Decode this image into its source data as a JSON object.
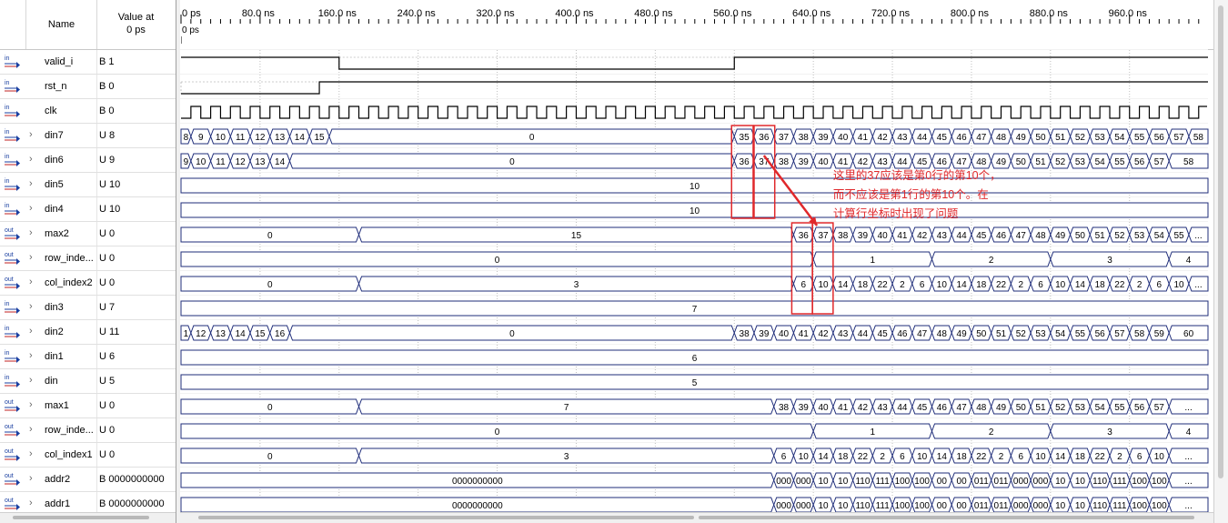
{
  "header": {
    "name_col": "Name",
    "value_col_line1": "Value at",
    "value_col_line2": "0 ps"
  },
  "timeline": {
    "ticks": [
      "0 ps",
      "80.0 ns",
      "160.0 ns",
      "240.0 ns",
      "320.0 ns",
      "400.0 ns",
      "480.0 ns",
      "560.0 ns",
      "640.0 ns",
      "720.0 ns",
      "800.0 ns",
      "880.0 ns",
      "960.0 ns"
    ],
    "cursor_label": "0 ps",
    "end_ns": 1038.5
  },
  "signals": [
    {
      "name": "valid_i",
      "value": "B 1",
      "dir": "in",
      "expandable": false
    },
    {
      "name": "rst_n",
      "value": "B 0",
      "dir": "in",
      "expandable": false
    },
    {
      "name": "clk",
      "value": "B 0",
      "dir": "in",
      "expandable": false
    },
    {
      "name": "din7",
      "value": "U 8",
      "dir": "in",
      "expandable": true
    },
    {
      "name": "din6",
      "value": "U 9",
      "dir": "in",
      "expandable": true
    },
    {
      "name": "din5",
      "value": "U 10",
      "dir": "in",
      "expandable": true
    },
    {
      "name": "din4",
      "value": "U 10",
      "dir": "in",
      "expandable": true
    },
    {
      "name": "max2",
      "value": "U 0",
      "dir": "out",
      "expandable": true
    },
    {
      "name": "row_inde...",
      "value": "U 0",
      "dir": "out",
      "expandable": true
    },
    {
      "name": "col_index2",
      "value": "U 0",
      "dir": "out",
      "expandable": true
    },
    {
      "name": "din3",
      "value": "U 7",
      "dir": "in",
      "expandable": true
    },
    {
      "name": "din2",
      "value": "U 11",
      "dir": "in",
      "expandable": true
    },
    {
      "name": "din1",
      "value": "U 6",
      "dir": "in",
      "expandable": true
    },
    {
      "name": "din",
      "value": "U 5",
      "dir": "in",
      "expandable": true
    },
    {
      "name": "max1",
      "value": "U 0",
      "dir": "out",
      "expandable": true
    },
    {
      "name": "row_inde...",
      "value": "U 0",
      "dir": "out",
      "expandable": true
    },
    {
      "name": "col_index1",
      "value": "U 0",
      "dir": "out",
      "expandable": true
    },
    {
      "name": "addr2",
      "value": "B 0000000000",
      "dir": "out",
      "expandable": true
    },
    {
      "name": "addr1",
      "value": "B 0000000000",
      "dir": "out",
      "expandable": true
    }
  ],
  "waveforms": {
    "valid_i": {
      "type": "bit",
      "edges": [
        [
          0,
          1
        ],
        [
          160,
          0
        ],
        [
          560,
          1
        ]
      ]
    },
    "rst_n": {
      "type": "bit",
      "edges": [
        [
          0,
          0
        ],
        [
          140,
          1
        ]
      ]
    },
    "clk": {
      "type": "clock",
      "period_ns": 20,
      "start_level": 0
    },
    "din7": {
      "type": "bus",
      "segs": [
        [
          0,
          "8"
        ],
        [
          10,
          "9"
        ],
        [
          30,
          "10"
        ],
        [
          50,
          "11"
        ],
        [
          70,
          "12"
        ],
        [
          90,
          "13"
        ],
        [
          110,
          "14"
        ],
        [
          130,
          "15"
        ],
        [
          150,
          "0"
        ],
        [
          560,
          "35"
        ],
        [
          580,
          "36"
        ],
        [
          600,
          "37"
        ],
        [
          620,
          "38"
        ],
        [
          640,
          "39"
        ],
        [
          660,
          "40"
        ],
        [
          680,
          "41"
        ],
        [
          700,
          "42"
        ],
        [
          720,
          "43"
        ],
        [
          740,
          "44"
        ],
        [
          760,
          "45"
        ],
        [
          780,
          "46"
        ],
        [
          800,
          "47"
        ],
        [
          820,
          "48"
        ],
        [
          840,
          "49"
        ],
        [
          860,
          "50"
        ],
        [
          880,
          "51"
        ],
        [
          900,
          "52"
        ],
        [
          920,
          "53"
        ],
        [
          940,
          "54"
        ],
        [
          960,
          "55"
        ],
        [
          980,
          "56"
        ],
        [
          1000,
          "57"
        ],
        [
          1020,
          "58"
        ]
      ]
    },
    "din6": {
      "type": "bus",
      "segs": [
        [
          0,
          "9"
        ],
        [
          10,
          "10"
        ],
        [
          30,
          "11"
        ],
        [
          50,
          "12"
        ],
        [
          70,
          "13"
        ],
        [
          90,
          "14"
        ],
        [
          110,
          "0"
        ],
        [
          560,
          "36"
        ],
        [
          580,
          "37"
        ],
        [
          600,
          "38"
        ],
        [
          620,
          "39"
        ],
        [
          640,
          "40"
        ],
        [
          660,
          "41"
        ],
        [
          680,
          "42"
        ],
        [
          700,
          "43"
        ],
        [
          720,
          "44"
        ],
        [
          740,
          "45"
        ],
        [
          760,
          "46"
        ],
        [
          780,
          "47"
        ],
        [
          800,
          "48"
        ],
        [
          820,
          "49"
        ],
        [
          840,
          "50"
        ],
        [
          860,
          "51"
        ],
        [
          880,
          "52"
        ],
        [
          900,
          "53"
        ],
        [
          920,
          "54"
        ],
        [
          940,
          "55"
        ],
        [
          960,
          "56"
        ],
        [
          980,
          "57"
        ],
        [
          1000,
          "58"
        ]
      ]
    },
    "din5": {
      "type": "bus",
      "segs": [
        [
          0,
          "10"
        ]
      ]
    },
    "din4": {
      "type": "bus",
      "segs": [
        [
          0,
          "10"
        ]
      ]
    },
    "max2": {
      "type": "bus",
      "segs": [
        [
          0,
          "0"
        ],
        [
          180,
          "15"
        ],
        [
          620,
          "36"
        ],
        [
          640,
          "37"
        ],
        [
          660,
          "38"
        ],
        [
          680,
          "39"
        ],
        [
          700,
          "40"
        ],
        [
          720,
          "41"
        ],
        [
          740,
          "42"
        ],
        [
          760,
          "43"
        ],
        [
          780,
          "44"
        ],
        [
          800,
          "45"
        ],
        [
          820,
          "46"
        ],
        [
          840,
          "47"
        ],
        [
          860,
          "48"
        ],
        [
          880,
          "49"
        ],
        [
          900,
          "50"
        ],
        [
          920,
          "51"
        ],
        [
          940,
          "52"
        ],
        [
          960,
          "53"
        ],
        [
          980,
          "54"
        ],
        [
          1000,
          "55"
        ],
        [
          1020,
          "..."
        ]
      ]
    },
    "row_index2": {
      "type": "bus",
      "segs": [
        [
          0,
          "0"
        ],
        [
          640,
          "1"
        ],
        [
          760,
          "2"
        ],
        [
          880,
          "3"
        ],
        [
          1000,
          "4"
        ]
      ]
    },
    "col_index2": {
      "type": "bus",
      "segs": [
        [
          0,
          "0"
        ],
        [
          180,
          "3"
        ],
        [
          620,
          "6"
        ],
        [
          640,
          "10"
        ],
        [
          660,
          "14"
        ],
        [
          680,
          "18"
        ],
        [
          700,
          "22"
        ],
        [
          720,
          "2"
        ],
        [
          740,
          "6"
        ],
        [
          760,
          "10"
        ],
        [
          780,
          "14"
        ],
        [
          800,
          "18"
        ],
        [
          820,
          "22"
        ],
        [
          840,
          "2"
        ],
        [
          860,
          "6"
        ],
        [
          880,
          "10"
        ],
        [
          900,
          "14"
        ],
        [
          920,
          "18"
        ],
        [
          940,
          "22"
        ],
        [
          960,
          "2"
        ],
        [
          980,
          "6"
        ],
        [
          1000,
          "10"
        ],
        [
          1020,
          "..."
        ]
      ]
    },
    "din3": {
      "type": "bus",
      "segs": [
        [
          0,
          "7"
        ]
      ]
    },
    "din2": {
      "type": "bus",
      "segs": [
        [
          0,
          "11"
        ],
        [
          10,
          "12"
        ],
        [
          30,
          "13"
        ],
        [
          50,
          "14"
        ],
        [
          70,
          "15"
        ],
        [
          90,
          "16"
        ],
        [
          110,
          "0"
        ],
        [
          560,
          "38"
        ],
        [
          580,
          "39"
        ],
        [
          600,
          "40"
        ],
        [
          620,
          "41"
        ],
        [
          640,
          "42"
        ],
        [
          660,
          "43"
        ],
        [
          680,
          "44"
        ],
        [
          700,
          "45"
        ],
        [
          720,
          "46"
        ],
        [
          740,
          "47"
        ],
        [
          760,
          "48"
        ],
        [
          780,
          "49"
        ],
        [
          800,
          "50"
        ],
        [
          820,
          "51"
        ],
        [
          840,
          "52"
        ],
        [
          860,
          "53"
        ],
        [
          880,
          "54"
        ],
        [
          900,
          "55"
        ],
        [
          920,
          "56"
        ],
        [
          940,
          "57"
        ],
        [
          960,
          "58"
        ],
        [
          980,
          "59"
        ],
        [
          1000,
          "60"
        ]
      ]
    },
    "din1": {
      "type": "bus",
      "segs": [
        [
          0,
          "6"
        ]
      ]
    },
    "din": {
      "type": "bus",
      "segs": [
        [
          0,
          "5"
        ]
      ]
    },
    "max1": {
      "type": "bus",
      "segs": [
        [
          0,
          "0"
        ],
        [
          180,
          "7"
        ],
        [
          600,
          "38"
        ],
        [
          620,
          "39"
        ],
        [
          640,
          "40"
        ],
        [
          660,
          "41"
        ],
        [
          680,
          "42"
        ],
        [
          700,
          "43"
        ],
        [
          720,
          "44"
        ],
        [
          740,
          "45"
        ],
        [
          760,
          "46"
        ],
        [
          780,
          "47"
        ],
        [
          800,
          "48"
        ],
        [
          820,
          "49"
        ],
        [
          840,
          "50"
        ],
        [
          860,
          "51"
        ],
        [
          880,
          "52"
        ],
        [
          900,
          "53"
        ],
        [
          920,
          "54"
        ],
        [
          940,
          "55"
        ],
        [
          960,
          "56"
        ],
        [
          980,
          "57"
        ],
        [
          1000,
          "..."
        ]
      ]
    },
    "row_index1": {
      "type": "bus",
      "segs": [
        [
          0,
          "0"
        ],
        [
          640,
          "1"
        ],
        [
          760,
          "2"
        ],
        [
          880,
          "3"
        ],
        [
          1000,
          "4"
        ]
      ]
    },
    "col_index1": {
      "type": "bus",
      "segs": [
        [
          0,
          "0"
        ],
        [
          180,
          "3"
        ],
        [
          600,
          "6"
        ],
        [
          620,
          "10"
        ],
        [
          640,
          "14"
        ],
        [
          660,
          "18"
        ],
        [
          680,
          "22"
        ],
        [
          700,
          "2"
        ],
        [
          720,
          "6"
        ],
        [
          740,
          "10"
        ],
        [
          760,
          "14"
        ],
        [
          780,
          "18"
        ],
        [
          800,
          "22"
        ],
        [
          820,
          "2"
        ],
        [
          840,
          "6"
        ],
        [
          860,
          "10"
        ],
        [
          880,
          "14"
        ],
        [
          900,
          "18"
        ],
        [
          920,
          "22"
        ],
        [
          940,
          "2"
        ],
        [
          960,
          "6"
        ],
        [
          980,
          "10"
        ],
        [
          1000,
          "..."
        ]
      ]
    },
    "addr2": {
      "type": "bus",
      "segs": [
        [
          0,
          "0000000000"
        ],
        [
          600,
          "000"
        ],
        [
          620,
          "000"
        ],
        [
          640,
          "10"
        ],
        [
          660,
          "10"
        ],
        [
          680,
          "110"
        ],
        [
          700,
          "111"
        ],
        [
          720,
          "100"
        ],
        [
          740,
          "100"
        ],
        [
          760,
          "00"
        ],
        [
          780,
          "00"
        ],
        [
          800,
          "011"
        ],
        [
          820,
          "011"
        ],
        [
          840,
          "000"
        ],
        [
          860,
          "000"
        ],
        [
          880,
          "10"
        ],
        [
          900,
          "10"
        ],
        [
          920,
          "110"
        ],
        [
          940,
          "111"
        ],
        [
          960,
          "100"
        ],
        [
          980,
          "100"
        ],
        [
          1000,
          "..."
        ]
      ]
    },
    "addr1": {
      "type": "bus",
      "segs": [
        [
          0,
          "0000000000"
        ],
        [
          600,
          "000"
        ],
        [
          620,
          "000"
        ],
        [
          640,
          "10"
        ],
        [
          660,
          "10"
        ],
        [
          680,
          "110"
        ],
        [
          700,
          "111"
        ],
        [
          720,
          "100"
        ],
        [
          740,
          "100"
        ],
        [
          760,
          "00"
        ],
        [
          780,
          "00"
        ],
        [
          800,
          "011"
        ],
        [
          820,
          "011"
        ],
        [
          840,
          "000"
        ],
        [
          860,
          "000"
        ],
        [
          880,
          "10"
        ],
        [
          900,
          "10"
        ],
        [
          920,
          "110"
        ],
        [
          940,
          "111"
        ],
        [
          960,
          "100"
        ],
        [
          980,
          "100"
        ],
        [
          1000,
          "..."
        ]
      ]
    }
  },
  "annotation": {
    "line1": "这里的37应该是第0行的第10个，",
    "line2": "而不应该是第1行的第10个。在",
    "line3": "计算行坐标时出现了问题",
    "color": "#e0282b"
  },
  "colors": {
    "bus": "#1f2d7a",
    "bit": "#000000",
    "grid": "#bfbfbf",
    "highlight": "#e0282b"
  }
}
